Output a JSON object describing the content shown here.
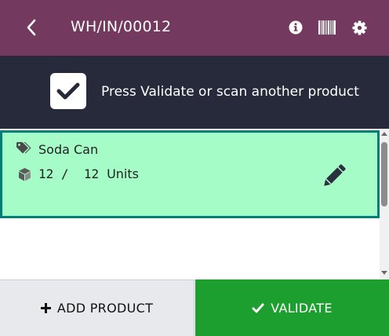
{
  "header": {
    "title": "WH/IN/00012",
    "back_icon": "chevron-left-icon",
    "info_icon": "info-icon",
    "barcode_icon": "barcode-icon",
    "settings_icon": "gear-icon"
  },
  "banner": {
    "message": "Press Validate or scan another product",
    "icon": "check-square-icon"
  },
  "lines": [
    {
      "product": "Soda Can",
      "product_icon": "tags-icon",
      "qty_done": "12",
      "separator": "/",
      "qty_demand": "12",
      "unit": "Units",
      "qty_icon": "cube-icon",
      "edit_icon": "pencil-icon",
      "status": "complete"
    }
  ],
  "footer": {
    "add_label": "ADD PRODUCT",
    "add_icon": "plus-icon",
    "validate_label": "VALIDATE",
    "validate_icon": "check-icon"
  },
  "colors": {
    "header_bg": "#74395f",
    "banner_bg": "#262a3a",
    "line_complete_bg": "#a6fcc7",
    "line_border": "#047c78",
    "validate_bg": "#1d9f2f",
    "add_bg": "#e7e9ed"
  }
}
